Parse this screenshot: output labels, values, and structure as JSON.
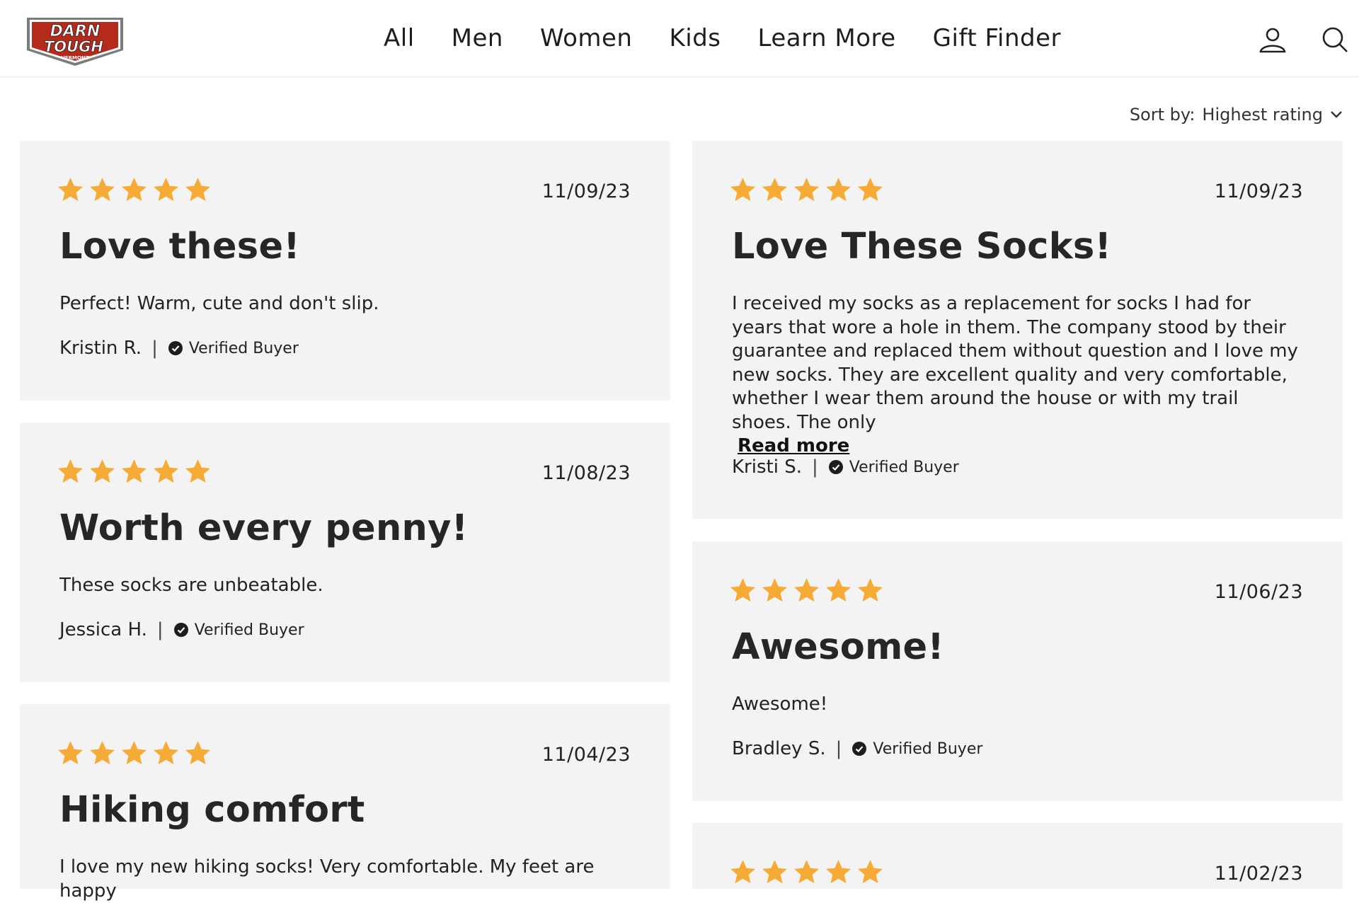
{
  "brand": {
    "logo_text_1": "DARN",
    "logo_text_2": "TOUGH",
    "logo_text_3": "VERMONT",
    "logo_red": "#b62a1c"
  },
  "nav": {
    "items": [
      {
        "label": "All"
      },
      {
        "label": "Men"
      },
      {
        "label": "Women"
      },
      {
        "label": "Kids"
      },
      {
        "label": "Learn More"
      },
      {
        "label": "Gift Finder"
      }
    ],
    "account_icon": "account-icon",
    "search_icon": "search-icon"
  },
  "sort": {
    "label": "Sort by:",
    "value": "Highest rating"
  },
  "colors": {
    "star": "#f6ab36",
    "card_bg": "#f4f3f3"
  },
  "reviews": [
    {
      "rating": 5,
      "date": "11/09/23",
      "title": "Love these!",
      "body": "Perfect! Warm, cute and don't slip.",
      "author": "Kristin R.",
      "badge": "Verified Buyer"
    },
    {
      "rating": 5,
      "date": "11/08/23",
      "title": "Worth every penny!",
      "body": "These socks are unbeatable.",
      "author": "Jessica H.",
      "badge": "Verified Buyer"
    },
    {
      "rating": 5,
      "date": "11/04/23",
      "title": "Hiking comfort",
      "body": "I love my new hiking socks! Very comfortable. My feet are happy",
      "author": "",
      "badge": ""
    },
    {
      "rating": 5,
      "date": "11/09/23",
      "title": "Love These Socks!",
      "body": "I received my socks as a replacement for socks I had for years that wore a hole in them. The company stood by their guarantee and replaced them without question and I love my new socks. They are excellent quality and very comfortable, whether I wear them around the house or with my trail shoes. The only",
      "read_more": "Read more",
      "author": "Kristi S.",
      "badge": "Verified Buyer"
    },
    {
      "rating": 5,
      "date": "11/06/23",
      "title": "Awesome!",
      "body": "Awesome!",
      "author": "Bradley S.",
      "badge": "Verified Buyer"
    },
    {
      "rating": 5,
      "date": "11/02/23",
      "title": "",
      "body": "",
      "author": "",
      "badge": ""
    }
  ]
}
